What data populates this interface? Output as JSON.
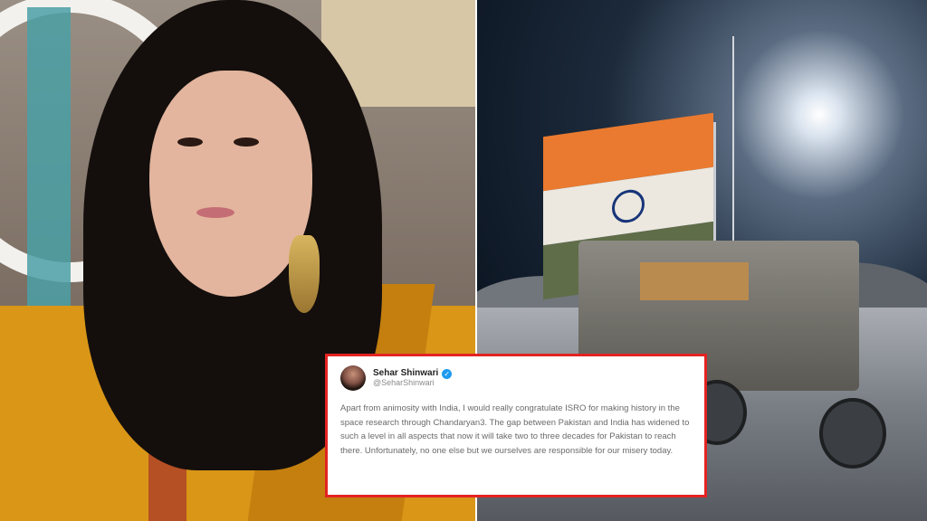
{
  "image": {
    "left_photo": "woman-portrait",
    "right_photo": "rover-with-indian-flag-on-moon"
  },
  "tweet": {
    "display_name": "Sehar Shinwari",
    "handle": "@SeharShinwari",
    "verified_icon": "verified-badge-icon",
    "text": "Apart from animosity with India, I would really congratulate ISRO for making history in the space research through Chandaryan3. The gap between Pakistan and India has widened to such a level in all aspects that now it will take two to three decades for Pakistan to reach there. Unfortunately, no one else but we ourselves are responsible for our misery today.",
    "border_color": "#e32323"
  }
}
